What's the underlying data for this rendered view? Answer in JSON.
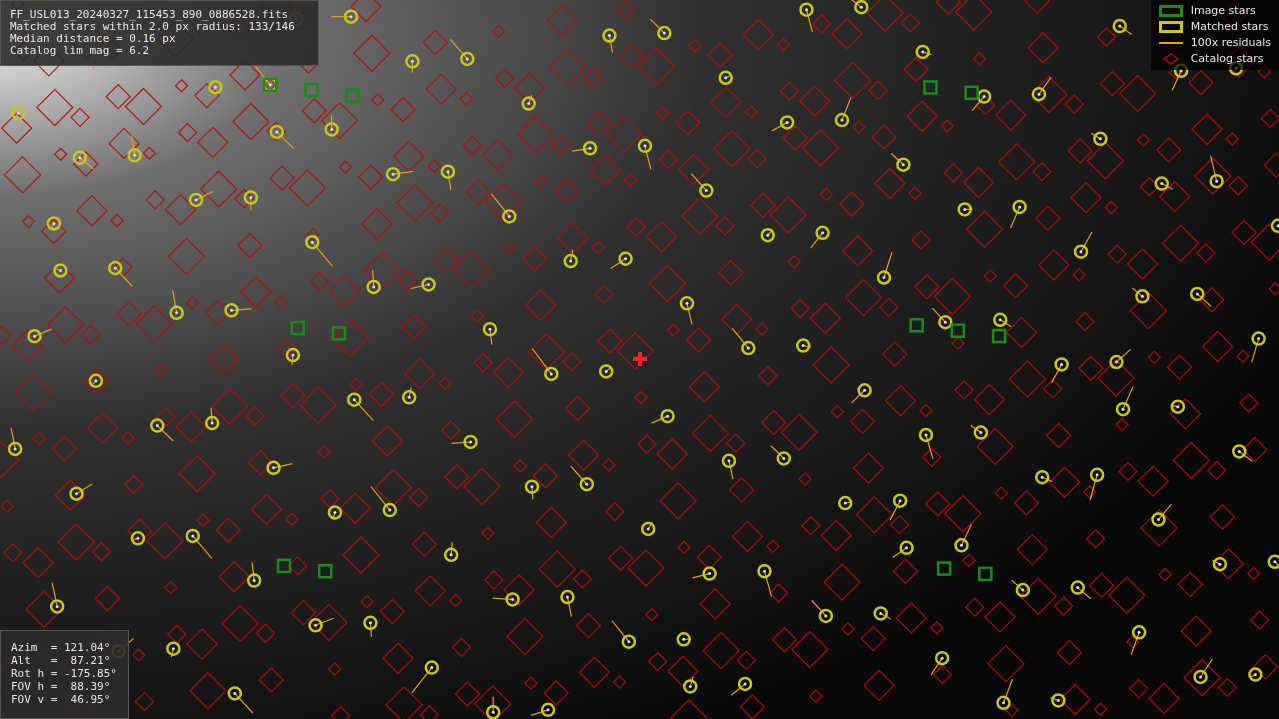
{
  "info_panel": {
    "lines": [
      "FF_USL013_20240327_115453_890_0886528.fits",
      "Matched stars within 2.0 px radius: 133/146",
      "Median distance = 0.16 px",
      "Catalog lim mag = 6.2"
    ]
  },
  "legend": [
    {
      "kind": "image",
      "label": "Image stars",
      "color": "#1a8c1a"
    },
    {
      "kind": "matched",
      "label": "Matched stars",
      "color": "#c8c81e"
    },
    {
      "kind": "residual",
      "label": "100x residuals",
      "color": "#e6a020"
    },
    {
      "kind": "catalog",
      "label": "Catalog stars",
      "color": "#b01010"
    }
  ],
  "pointing_panel": {
    "lines": [
      "Azim  = 121.04°",
      "Alt   =  87.21°",
      "Rot h = -175.85°",
      "FOV h =  88.39°",
      "FOV v =  46.95°"
    ]
  }
}
